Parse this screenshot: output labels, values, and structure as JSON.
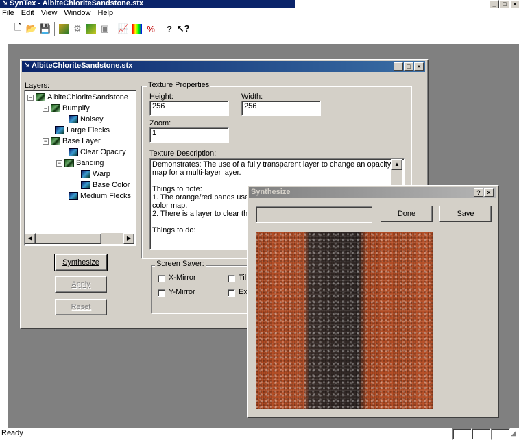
{
  "app": {
    "title": "SynTex - AlbiteChloriteSandstone.stx",
    "menu": [
      "File",
      "Edit",
      "View",
      "Window",
      "Help"
    ],
    "toolbar_icons": [
      "new-icon",
      "open-icon",
      "save-icon",
      "layer-icon",
      "wheel-icon",
      "cube-icon",
      "disk-icon",
      "chart-icon",
      "palette-icon",
      "percent-icon",
      "help-icon",
      "context-help-icon"
    ],
    "status": "Ready"
  },
  "doc": {
    "title": "AlbiteChloriteSandstone.stx",
    "layers_label": "Layers:",
    "tree": [
      {
        "label": "AlbiteChloriteSandstone",
        "icon": "multi-layer-icon"
      },
      {
        "label": "Bumpify",
        "icon": "multi-layer-icon"
      },
      {
        "label": "Noisey",
        "icon": "layer-icon"
      },
      {
        "label": "Large Flecks",
        "icon": "layer-icon"
      },
      {
        "label": "Base Layer",
        "icon": "multi-layer-icon"
      },
      {
        "label": "Clear Opacity",
        "icon": "layer-icon"
      },
      {
        "label": "Banding",
        "icon": "multi-layer-icon"
      },
      {
        "label": "Warp",
        "icon": "layer-icon"
      },
      {
        "label": "Base Color",
        "icon": "layer-icon"
      },
      {
        "label": "Medium Flecks",
        "icon": "layer-icon"
      }
    ],
    "buttons": {
      "synthesize": "Synthesize",
      "apply": "Apply",
      "reset": "Reset"
    },
    "props": {
      "group_label": "Texture Properties",
      "height_label": "Height:",
      "height_value": "256",
      "width_label": "Width:",
      "width_value": "256",
      "zoom_label": "Zoom:",
      "zoom_value": "1",
      "desc_label": "Texture Description:",
      "desc_lines": [
        "Demonstrates: The use of a fully transparent layer to change an opacity",
        "map for a multi-layer layer.",
        "",
        "Things to note:",
        "1. The orange/red bands use",
        "color map.",
        "2. There is a layer to clear the",
        "",
        "Things to do:"
      ]
    },
    "screensaver": {
      "group_label": "Screen Saver:",
      "x_mirror": "X-Mirror",
      "y_mirror": "Y-Mirror",
      "tile": "Til",
      "ex": "Ex"
    }
  },
  "synth": {
    "title": "Synthesize",
    "done": "Done",
    "save": "Save",
    "colors": {
      "orange": "#b04a22",
      "dark": "#3a2e2a"
    }
  }
}
